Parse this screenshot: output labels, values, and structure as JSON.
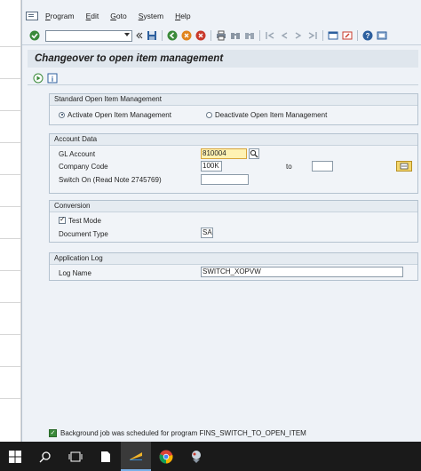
{
  "menu": {
    "items": [
      {
        "label": "Program",
        "key": "P",
        "rest": "rogram"
      },
      {
        "label": "Edit",
        "key": "E",
        "rest": "dit"
      },
      {
        "label": "Goto",
        "key": "G",
        "rest": "oto"
      },
      {
        "label": "System",
        "key": "S",
        "rest": "ystem"
      },
      {
        "label": "Help",
        "key": "H",
        "rest": "elp"
      }
    ]
  },
  "toolbar": {
    "command_field_value": ""
  },
  "title": "Changeover to open item management",
  "groups": {
    "standard": {
      "title": "Standard Open Item Management",
      "activate_label": "Activate Open Item Management",
      "deactivate_label": "Deactivate Open Item Management",
      "selected": "activate"
    },
    "account": {
      "title": "Account Data",
      "gl_account_label": "GL Account",
      "gl_account_value": "810004",
      "company_code_label": "Company Code",
      "company_code_value": "100K",
      "to_label": "to",
      "to_value": "",
      "switch_on_label": "Switch On (Read Note 2745769)",
      "switch_on_value": ""
    },
    "conversion": {
      "title": "Conversion",
      "test_mode_label": "Test Mode",
      "test_mode_checked": true,
      "doc_type_label": "Document Type",
      "doc_type_value": "SA"
    },
    "applog": {
      "title": "Application Log",
      "log_name_label": "Log Name",
      "log_name_value": "SWITCH_XOPVW"
    }
  },
  "status": {
    "message": "Background job was scheduled for program FINS_SWITCH_TO_OPEN_ITEM"
  },
  "colors": {
    "window_bg": "#eef2f7",
    "highlight_field": "#fff2b3",
    "taskbar": "#1a1a1a"
  }
}
